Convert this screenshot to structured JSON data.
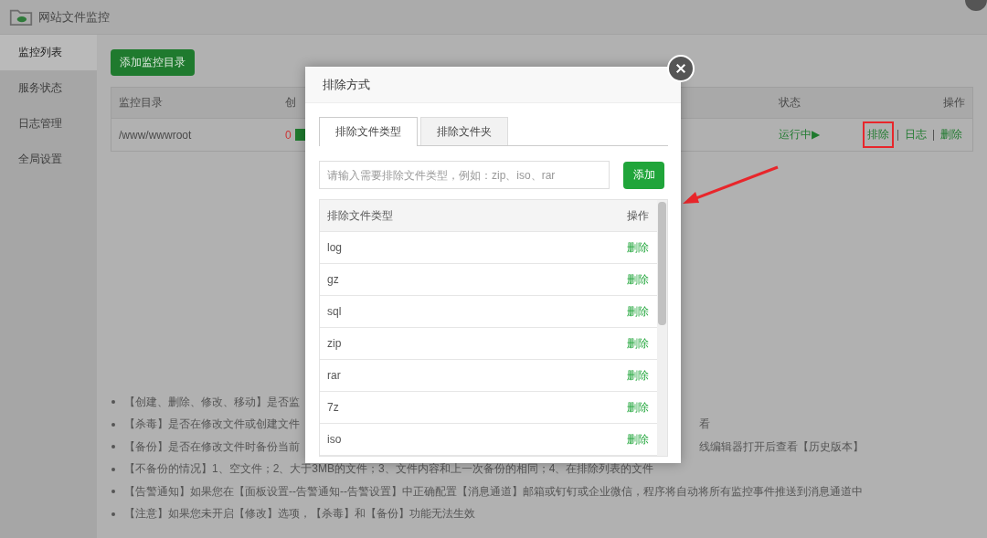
{
  "window": {
    "title": "网站文件监控"
  },
  "sidebar": {
    "items": [
      {
        "label": "监控列表",
        "selected": true
      },
      {
        "label": "服务状态",
        "selected": false
      },
      {
        "label": "日志管理",
        "selected": false
      },
      {
        "label": "全局设置",
        "selected": false
      }
    ]
  },
  "add_button": "添加监控目录",
  "table": {
    "columns": [
      "监控目录",
      "创",
      "状态",
      "操作"
    ],
    "rows": [
      {
        "path": "/www/wwwroot",
        "count": "0",
        "checked": true,
        "status": "运行中▶",
        "actions": [
          {
            "label": "排除",
            "highlighted": true
          },
          {
            "label": "日志",
            "highlighted": false
          },
          {
            "label": "删除",
            "highlighted": false
          }
        ]
      }
    ]
  },
  "notices": [
    {
      "text": "【创建、删除、修改、移动】是否监"
    },
    {
      "text": "【杀毒】是否在修改文件或创建文件",
      "right": "看"
    },
    {
      "text": "【备份】是否在修改文件时备份当前",
      "right": "线编辑器打开后查看【历史版本】"
    },
    {
      "text": "【不备份的情况】1、空文件；2、大于3MB的文件；3、文件内容和上一次备份的相同；4、在排除列表的文件"
    },
    {
      "text": "【告警通知】如果您在【面板设置--告警通知--告警设置】中正确配置【消息通道】邮箱或钉钉或企业微信，程序将自动将所有监控事件推送到消息通道中"
    },
    {
      "text": "【注意】如果您未开启【修改】选项，【杀毒】和【备份】功能无法生效"
    }
  ],
  "dialog": {
    "title": "排除方式",
    "tabs": [
      {
        "label": "排除文件类型",
        "selected": true
      },
      {
        "label": "排除文件夹",
        "selected": false
      }
    ],
    "input": {
      "placeholder": "请输入需要排除文件类型，例如：zip、iso、rar"
    },
    "add_button": "添加",
    "columns": [
      "排除文件类型",
      "操作"
    ],
    "rows": [
      {
        "type": "log",
        "action": "删除"
      },
      {
        "type": "gz",
        "action": "删除"
      },
      {
        "type": "sql",
        "action": "删除"
      },
      {
        "type": "zip",
        "action": "删除"
      },
      {
        "type": "rar",
        "action": "删除"
      },
      {
        "type": "7z",
        "action": "删除"
      },
      {
        "type": "iso",
        "action": "删除"
      }
    ]
  }
}
